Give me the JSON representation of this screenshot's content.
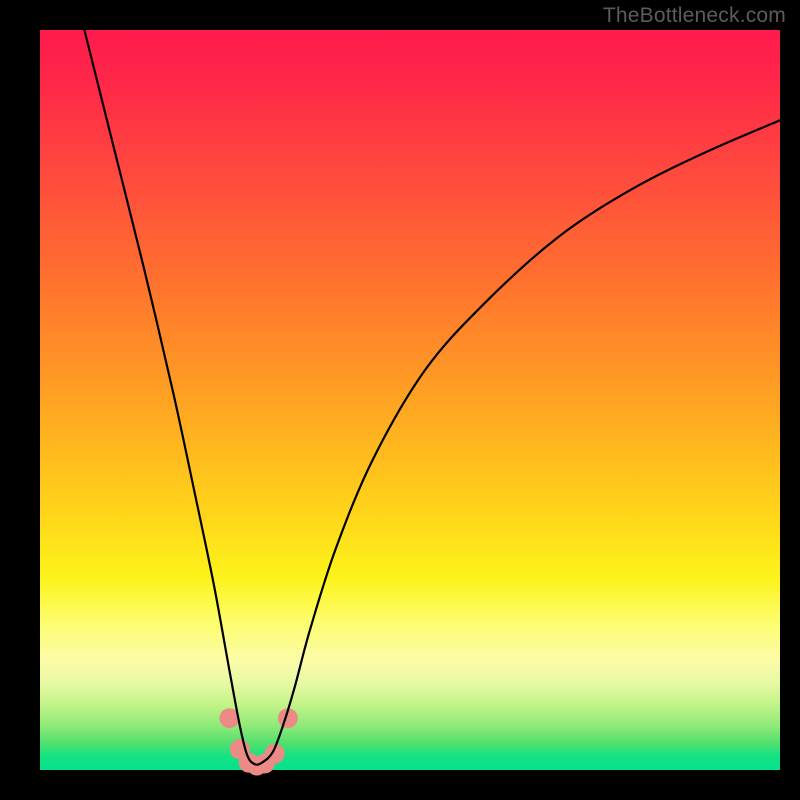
{
  "watermark": "TheBottleneck.com",
  "chart_data": {
    "type": "line",
    "title": "",
    "xlabel": "",
    "ylabel": "",
    "xlim": [
      0,
      100
    ],
    "ylim": [
      0,
      100
    ],
    "gradient_stops": [
      {
        "pos": 0,
        "color": "#ff1a4d"
      },
      {
        "pos": 20,
        "color": "#ff4b3d"
      },
      {
        "pos": 45,
        "color": "#ff9326"
      },
      {
        "pos": 66,
        "color": "#ffd71a"
      },
      {
        "pos": 80,
        "color": "#fdfd6e"
      },
      {
        "pos": 94,
        "color": "#8fea78"
      },
      {
        "pos": 100,
        "color": "#05e28e"
      }
    ],
    "series": [
      {
        "name": "bottleneck-curve",
        "color": "#000000",
        "x": [
          6.0,
          10.0,
          14.0,
          18.0,
          21.0,
          23.5,
          25.5,
          27.0,
          28.0,
          29.0,
          30.0,
          31.5,
          33.0,
          34.5,
          36.5,
          40.0,
          45.0,
          52.0,
          60.0,
          70.0,
          80.0,
          90.0,
          100.0
        ],
        "y": [
          100.0,
          84.0,
          68.0,
          51.0,
          37.0,
          25.0,
          14.0,
          6.0,
          2.0,
          0.8,
          1.0,
          2.5,
          6.5,
          11.5,
          19.0,
          30.0,
          42.0,
          54.0,
          63.0,
          72.0,
          78.5,
          83.5,
          87.8
        ]
      }
    ],
    "markers": {
      "name": "bottleneck-markers",
      "color": "#ec8b85",
      "radius_rel": 1.35,
      "x": [
        25.6,
        27.0,
        28.2,
        29.3,
        30.4,
        31.7,
        33.5
      ],
      "y": [
        7.0,
        2.8,
        1.0,
        0.6,
        0.9,
        2.2,
        7.0
      ]
    }
  }
}
